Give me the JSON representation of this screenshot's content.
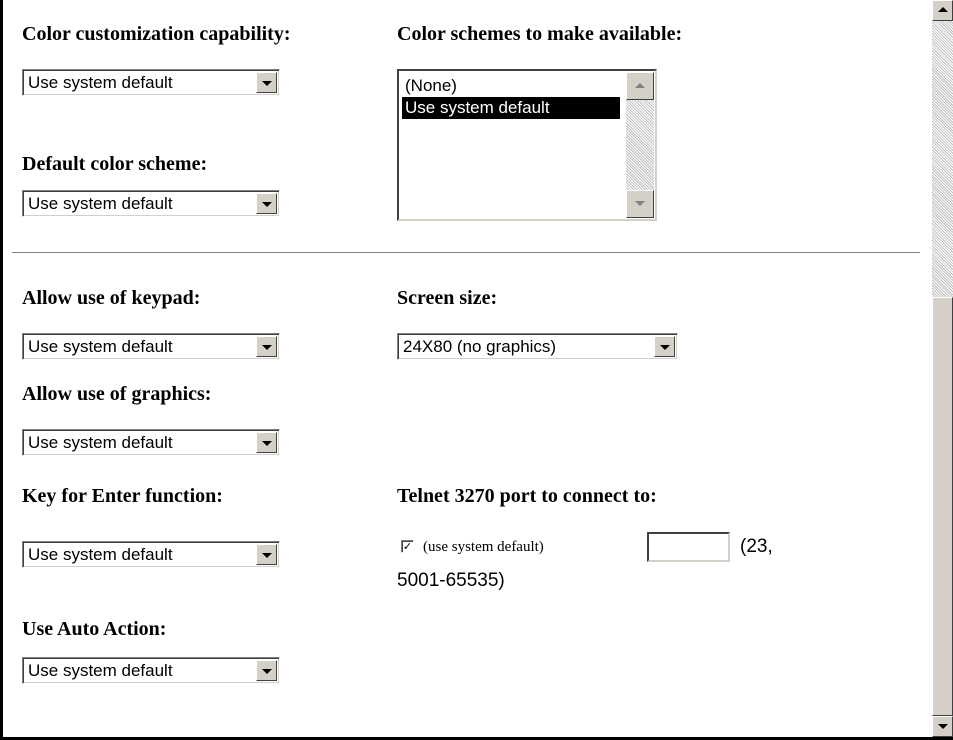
{
  "form": {
    "color_customization": {
      "label": "Color customization capability:",
      "value": "Use system default"
    },
    "color_schemes": {
      "label": "Color schemes to make available:",
      "options": [
        "(None)",
        "Use system default"
      ],
      "selected": "Use system default"
    },
    "default_color_scheme": {
      "label": "Default color scheme:",
      "value": "Use system default"
    },
    "keypad": {
      "label": "Allow use of keypad:",
      "value": "Use system default"
    },
    "screen_size": {
      "label": "Screen size:",
      "value": "24X80 (no graphics)"
    },
    "graphics": {
      "label": "Allow use of graphics:",
      "value": "Use system default"
    },
    "enter_key": {
      "label": "Key for Enter function:",
      "value": "Use system default"
    },
    "telnet_port": {
      "label": "Telnet 3270 port to connect to:",
      "checkbox_checked": true,
      "checkbox_mark": "✓",
      "checkbox_label": "(use system default)",
      "port_value": "",
      "range_text_line1": "(23,",
      "range_text_line2": "5001-65535)"
    },
    "auto_action": {
      "label": "Use Auto Action:",
      "value": "Use system default"
    }
  },
  "colors": {
    "listbox_selected_bg": "#000000",
    "chrome_gray": "#d4d0c8"
  }
}
